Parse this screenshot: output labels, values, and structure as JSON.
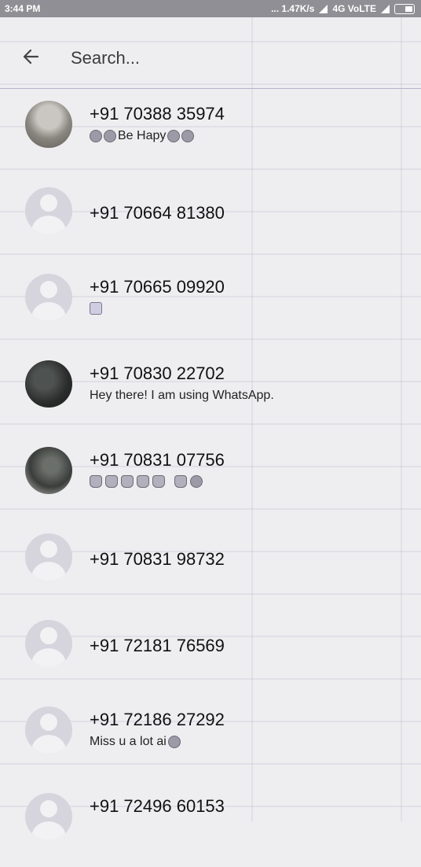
{
  "status_bar": {
    "time": "3:44 PM",
    "network_speed": "... 1.47K/s",
    "network_type": "4G VoLTE"
  },
  "search": {
    "placeholder": "Search..."
  },
  "contacts": [
    {
      "name": "+91 70388 35974",
      "status": "Be Hap​y",
      "avatar": "photo"
    },
    {
      "name": "+91 70664 81380",
      "status": "",
      "avatar": "default"
    },
    {
      "name": "+91 70665 09920",
      "status": "",
      "avatar": "default"
    },
    {
      "name": "+91 70830 22702",
      "status": "Hey there! I am using WhatsApp.",
      "avatar": "photo"
    },
    {
      "name": "+91 70831 07756",
      "status": "",
      "avatar": "photo"
    },
    {
      "name": "+91 70831 98732",
      "status": "",
      "avatar": "default"
    },
    {
      "name": "+91 72181 76569",
      "status": "",
      "avatar": "default"
    },
    {
      "name": "+91 72186 27292",
      "status": "Miss u a lot  ai",
      "avatar": "default"
    },
    {
      "name": "+91 72496 60153",
      "status": "",
      "avatar": "default"
    }
  ],
  "icons": {
    "back": "arrow-left-icon",
    "battery": "battery-icon",
    "signal": "signal-icon"
  },
  "colors": {
    "status_bar": "#8f8f95",
    "background": "#eeedf0",
    "divider": "#b7b2cc"
  }
}
